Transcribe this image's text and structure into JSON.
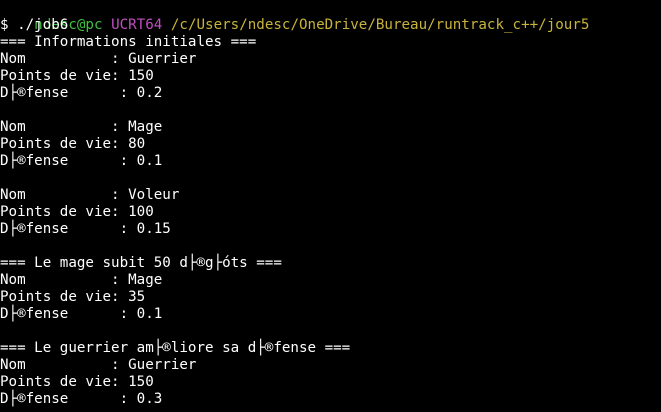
{
  "prompt": {
    "user_host": "ndesc@pc",
    "shell": "UCRT64",
    "path": "/c/Users/ndesc/OneDrive/Bureau/runtrack_c++/jour5"
  },
  "colors": {
    "background": "#000000",
    "text": "#ffffff",
    "user_host": "#3fbf3f",
    "shell": "#c050c0",
    "path": "#c8b43c"
  },
  "output": {
    "lines": [
      "$ ./job6",
      "=== Informations initiales ===",
      "Nom          : Guerrier",
      "Points de vie: 150",
      "D├®fense      : 0.2",
      "",
      "Nom          : Mage",
      "Points de vie: 80",
      "D├®fense      : 0.1",
      "",
      "Nom          : Voleur",
      "Points de vie: 100",
      "D├®fense      : 0.15",
      "",
      "=== Le mage subit 50 d├®g├óts ===",
      "Nom          : Mage",
      "Points de vie: 35",
      "D├®fense      : 0.1",
      "",
      "=== Le guerrier am├®liore sa d├®fense ===",
      "Nom          : Guerrier",
      "Points de vie: 150",
      "D├®fense      : 0.3"
    ]
  }
}
